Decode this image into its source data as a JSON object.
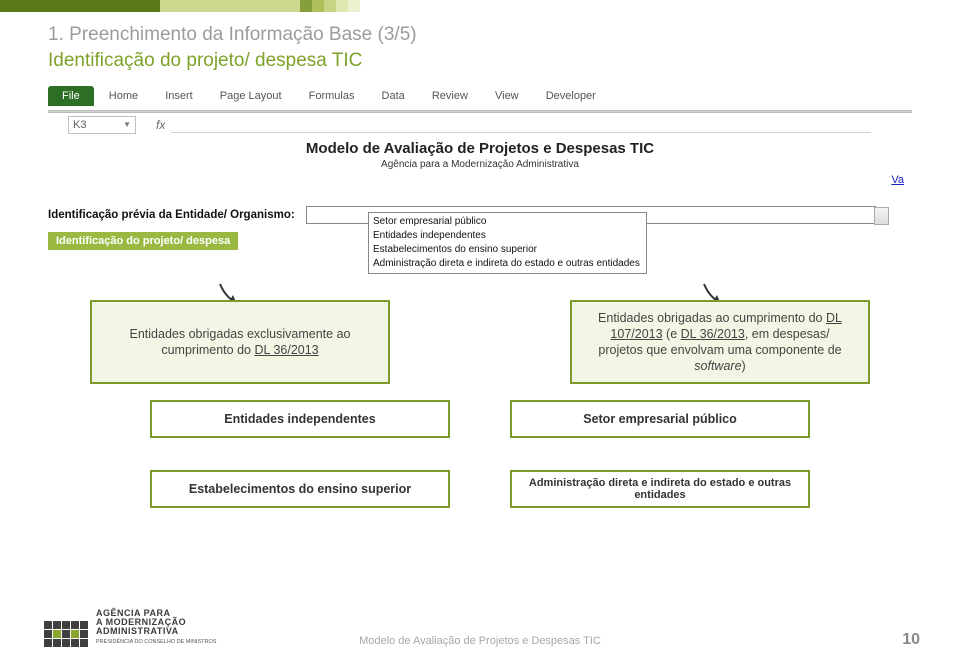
{
  "header": {
    "title_line1": "1. Preenchimento da Informação Base (3/5)",
    "title_line2": "Identificação do projeto/ despesa TIC"
  },
  "ribbon": {
    "file": "File",
    "tabs": [
      "Home",
      "Insert",
      "Page Layout",
      "Formulas",
      "Data",
      "Review",
      "View",
      "Developer"
    ],
    "namebox": "K3",
    "fx_label": "fx"
  },
  "sheet": {
    "title": "Modelo de Avaliação de Projetos e Despesas TIC",
    "subtitle": "Agência para a Modernização Administrativa",
    "va_link": "Va",
    "ident_prev_label": "Identificação prévia da Entidade/ Organismo:",
    "section_band": "Identificação do projeto/ despesa",
    "dropdown_options": [
      "Setor empresarial público",
      "Entidades independentes",
      "Estabelecimentos do ensino superior",
      "Administração direta e indireta do estado e outras entidades"
    ]
  },
  "boxes": {
    "left_main_pre": "Entidades obrigadas exclusivamente ao cumprimento do ",
    "left_main_u": "DL 36/2013",
    "right_main_pre": "Entidades obrigadas ao cumprimento do ",
    "right_main_u1": "DL 107/2013",
    "right_main_mid": " (e ",
    "right_main_u2": "DL 36/2013",
    "right_main_post1": ", em despesas/ projetos que envolvam uma componente de ",
    "right_main_sw": "software",
    "right_main_post2": ")",
    "row2_left": "Entidades independentes",
    "row2_right": "Setor empresarial público",
    "row3_left": "Estabelecimentos do ensino superior",
    "row3_right": "Administração direta e indireta do estado e outras entidades"
  },
  "footer": {
    "agency_l1": "AGÊNCIA PARA",
    "agency_l2": "A MODERNIZAÇÃO",
    "agency_l3": "ADMINISTRATIVA",
    "agency_l4": "PRESIDÊNCIA DO CONSELHO DE MINISTROS",
    "center": "Modelo de Avaliação de Projetos e Despesas TIC",
    "page": "10"
  }
}
